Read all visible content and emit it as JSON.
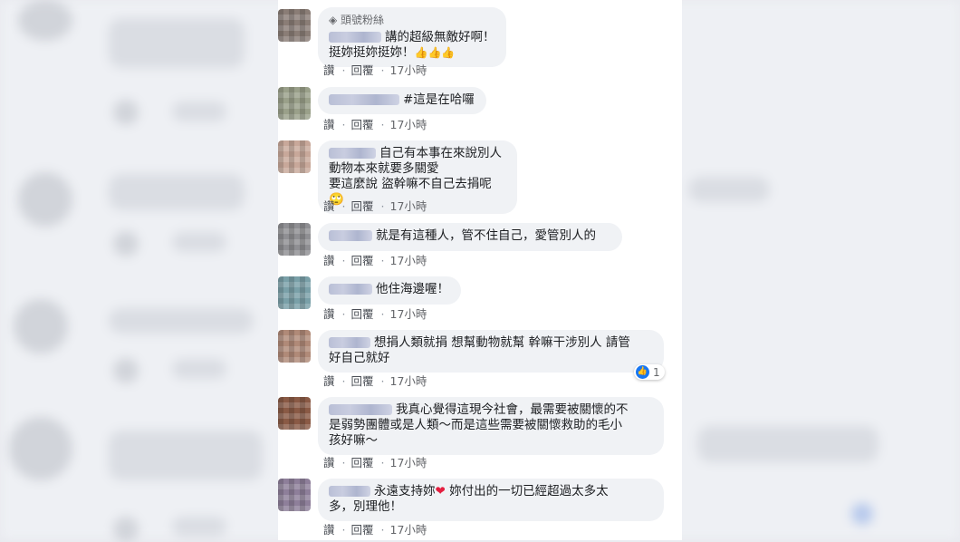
{
  "comments": [
    {
      "badge": "頭號粉絲",
      "lines": [
        "講的超級無敵好啊！",
        "挺妳挺妳挺妳！"
      ],
      "emoji": "👍👍👍",
      "actions": {
        "like": "讚",
        "reply": "回覆",
        "time": "17小時"
      }
    },
    {
      "lines": [
        "#這是在哈囉"
      ],
      "actions": {
        "like": "讚",
        "reply": "回覆",
        "time": "17小時"
      }
    },
    {
      "lines": [
        "自己有本事在來說別人",
        "動物本來就要多關愛",
        "要這麼說 盜幹嘛不自己去捐呢"
      ],
      "emoji": "🙄",
      "actions": {
        "like": "讚",
        "reply": "回覆",
        "time": "17小時"
      }
    },
    {
      "lines": [
        "就是有這種人，管不住自己，愛管別人的"
      ],
      "actions": {
        "like": "讚",
        "reply": "回覆",
        "time": "17小時"
      }
    },
    {
      "lines": [
        "他住海邊喔！"
      ],
      "actions": {
        "like": "讚",
        "reply": "回覆",
        "time": "17小時"
      }
    },
    {
      "lines": [
        "想捐人類就捐 想幫動物就幫 幹嘛干涉別人 請管",
        "好自己就好"
      ],
      "reaction_count": "1",
      "actions": {
        "like": "讚",
        "reply": "回覆",
        "time": "17小時"
      }
    },
    {
      "lines": [
        "我真心覺得這現今社會，最需要被關懷的不",
        "是弱勢團體或是人類～而是這些需要被關懷救助的毛小",
        "孩好嘛～"
      ],
      "actions": {
        "like": "讚",
        "reply": "回覆",
        "time": "17小時"
      }
    },
    {
      "lines_a": "永遠支持妳",
      "heart": "❤",
      "lines_b": "妳付出的一切已經超過太多太",
      "lines_c": "多，別理他！",
      "actions": {
        "like": "讚",
        "reply": "回覆",
        "time": "17小時"
      }
    }
  ],
  "avatar_colors": [
    "#8a7d76",
    "#9aa08a",
    "#c8a89a",
    "#8f8f93",
    "#7aa0a8",
    "#b08a78",
    "#8a5a45",
    "#8e7f9a"
  ]
}
